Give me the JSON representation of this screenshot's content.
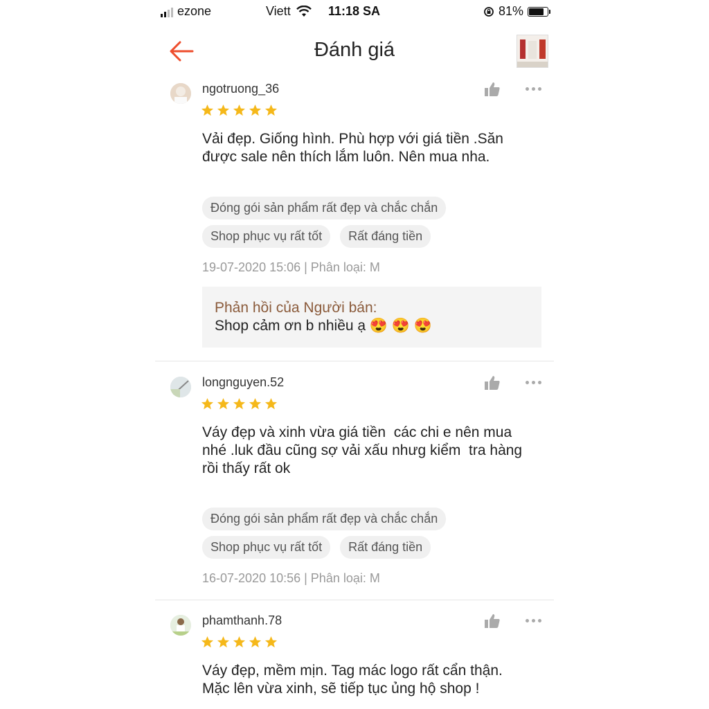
{
  "status_bar": {
    "carrier1": "ezone",
    "carrier2": "Viett",
    "time": "11:18 SA",
    "battery": "81%"
  },
  "header": {
    "title": "Đánh giá",
    "back_icon": "arrow-left-icon"
  },
  "colors": {
    "accent": "#ee4d2d",
    "star": "#f5b81a",
    "reply_title": "#8a5a3a"
  },
  "reviews": [
    {
      "user": "ngotruong_36",
      "rating": 5,
      "text1": "Vải đẹp. Giống hình. Phù hợp với giá tiền .Săn",
      "text2": "được sale nên thích lắm luôn. Nên mua nha.",
      "tags": [
        "Đóng gói sản phẩm rất đẹp và chắc chắn",
        "Shop phục vụ rất tốt",
        "Rất đáng tiền"
      ],
      "meta": "19-07-2020 15:06 | Phân loại: M",
      "reply_title": "Phản hồi của Người bán:",
      "reply_text": "Shop cảm ơn b nhiều ạ 😍 😍 😍"
    },
    {
      "user": "longnguyen.52",
      "rating": 5,
      "text1": "Váy đẹp và xinh vừa giá tiền  các chi e nên mua",
      "text2": "nhé .luk đầu cũng sợ vải xấu nhưg kiểm  tra hàng",
      "text3": "rồi thấy rất ok",
      "tags": [
        "Đóng gói sản phẩm rất đẹp và chắc chắn",
        "Shop phục vụ rất tốt",
        "Rất đáng tiền"
      ],
      "meta": "16-07-2020 10:56 | Phân loại: M"
    },
    {
      "user": "phamthanh.78",
      "rating": 5,
      "text1": "Váy đẹp, mềm mịn. Tag mác logo rất cẩn thận.",
      "text2": "Mặc lên vừa xinh, sẽ tiếp tục ủng hộ shop !"
    }
  ]
}
